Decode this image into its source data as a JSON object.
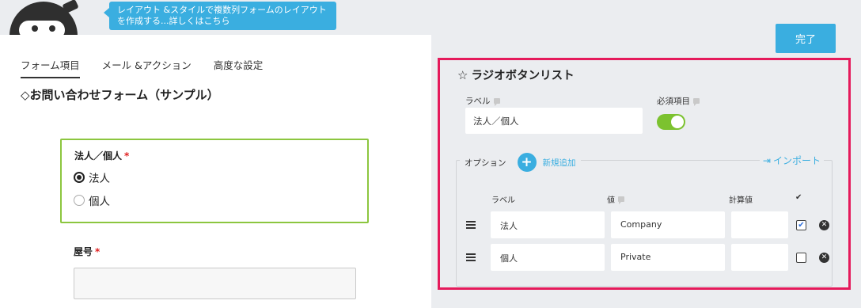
{
  "help_tooltip": {
    "line1": "レイアウト &スタイルで複数列フォームのレイアウト",
    "line2": "を作成する...詳しくはこちら"
  },
  "tabs": [
    "フォーム項目",
    "メール &アクション",
    "高度な設定"
  ],
  "active_tab": "フォーム項目",
  "form_title": "◇お問い合わせフォーム（サンプル）",
  "field_corporate": {
    "label": "法人／個人",
    "required_mark": "*",
    "options": [
      "法人",
      "個人"
    ],
    "selected": "法人"
  },
  "field_yago": {
    "label": "屋号",
    "required_mark": "*",
    "value": ""
  },
  "done_button": "完了",
  "settings_panel": {
    "star_icon": "☆",
    "title": "ラジオボタンリスト",
    "label_caption": "ラベル",
    "label_value": "法人／個人",
    "required_caption": "必須項目",
    "required_on": true,
    "options_caption": "オプション",
    "add_new_label": "新規追加",
    "import_label": "インポート",
    "columns": {
      "label": "ラベル",
      "value": "値",
      "calc": "計算値",
      "check": "✔"
    },
    "rows": [
      {
        "label": "法人",
        "value": "Company",
        "calc": "",
        "checked": true
      },
      {
        "label": "個人",
        "value": "Private",
        "calc": "",
        "checked": false
      }
    ]
  },
  "colors": {
    "accent_blue": "#3aaee0",
    "highlight_pink": "#e51a5b",
    "active_green": "#8cc63f",
    "toggle_green": "#7cc22f"
  }
}
